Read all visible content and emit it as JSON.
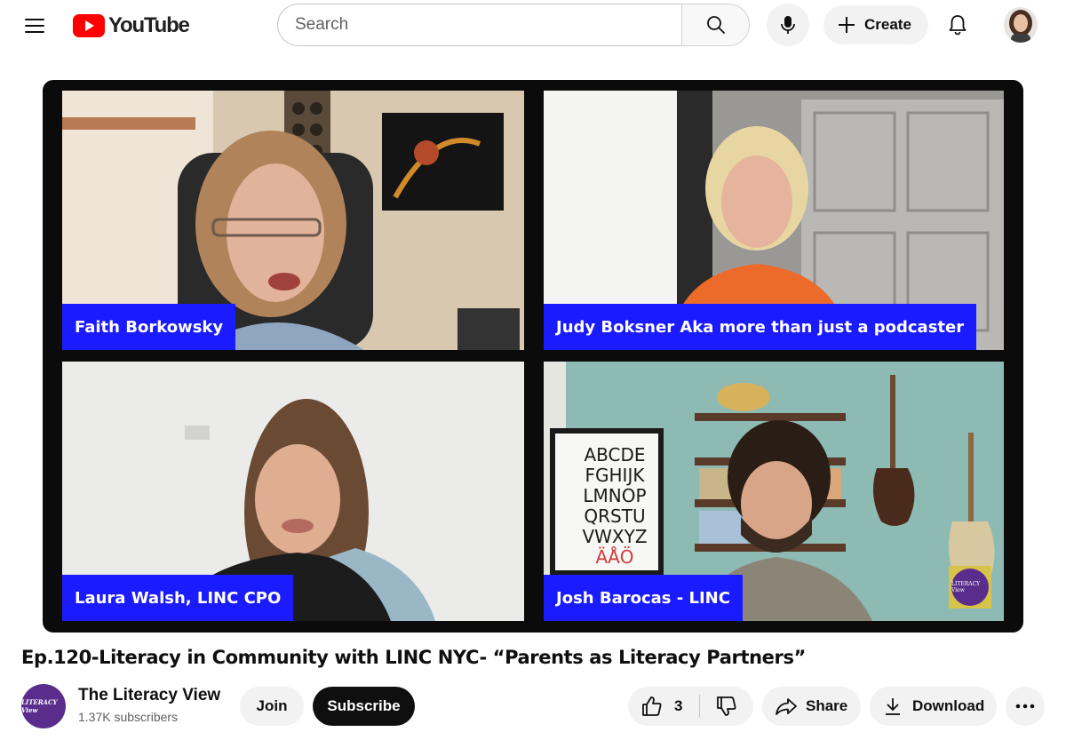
{
  "header": {
    "logo_text": "YouTube",
    "search_placeholder": "Search",
    "create_label": "Create"
  },
  "video": {
    "participants": [
      {
        "name": "Faith Borkowsky"
      },
      {
        "name": "Judy Boksner Aka more than just a podcaster"
      },
      {
        "name": "Laura Walsh, LINC CPO"
      },
      {
        "name": "Josh Barocas - LINC"
      }
    ],
    "alphabet_poster": [
      "ABCDE",
      "FGHIJK",
      "LMNOP",
      "QRSTU",
      "VWXYZ",
      "ÄÅÖ"
    ],
    "watermark_logo": "LITERACY View",
    "title": "Ep.120-Literacy in Community with LINC NYC- “Parents as Literacy Partners”"
  },
  "channel": {
    "avatar_logo": "LITERACY View",
    "name": "The Literacy View",
    "subscribers": "1.37K subscribers",
    "join_label": "Join",
    "subscribe_label": "Subscribe"
  },
  "actions": {
    "like_count": "3",
    "share_label": "Share",
    "download_label": "Download"
  },
  "colors": {
    "brand_red": "#ff0000",
    "nametag_blue": "#1b1bff",
    "subscribe_black": "#0f0f0f",
    "channel_purple": "#5a2d8c"
  }
}
